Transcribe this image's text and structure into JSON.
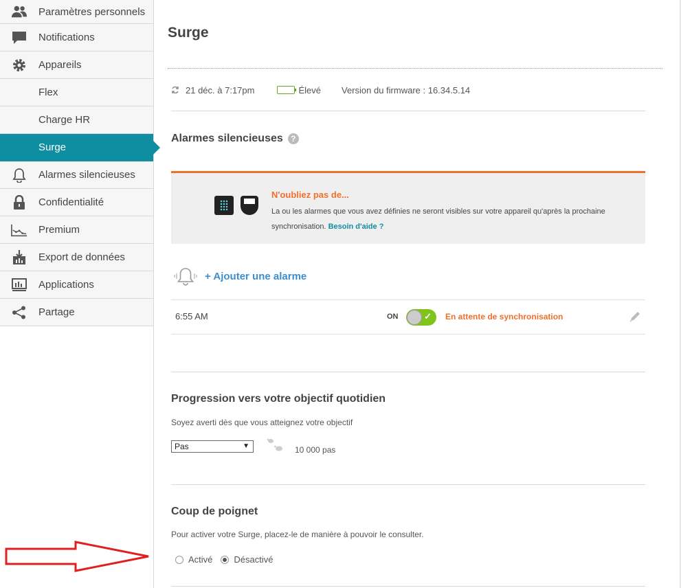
{
  "sidebar": {
    "items": [
      {
        "label": "Paramètres personnels",
        "icon": "users-icon"
      },
      {
        "label": "Notifications",
        "icon": "speech-bubble-icon"
      },
      {
        "label": "Appareils",
        "icon": "gear-icon"
      },
      {
        "label": "Flex",
        "icon": ""
      },
      {
        "label": "Charge HR",
        "icon": ""
      },
      {
        "label": "Surge",
        "icon": ""
      },
      {
        "label": "Alarmes silencieuses",
        "icon": "bell-icon"
      },
      {
        "label": "Confidentialité",
        "icon": "lock-icon"
      },
      {
        "label": "Premium",
        "icon": "line-chart-icon"
      },
      {
        "label": "Export de données",
        "icon": "download-icon"
      },
      {
        "label": "Applications",
        "icon": "monitor-icon"
      },
      {
        "label": "Partage",
        "icon": "share-icon"
      }
    ],
    "active": "Surge"
  },
  "main": {
    "title": "Surge",
    "status": {
      "sync_time": "21 déc. à 7:17pm",
      "battery_label": "Élevé",
      "firmware": "Version du firmware : 16.34.5.14"
    },
    "alarms": {
      "title": "Alarmes silencieuses",
      "help": "?",
      "notice_title": "N'oubliez pas de...",
      "notice_text": "La ou les alarmes que vous avez définies ne seront visibles sur votre appareil qu'après la prochaine synchronisation.",
      "notice_link": "Besoin d'aide ?",
      "add_label": "+ Ajouter une alarme",
      "list": [
        {
          "time": "6:55 AM",
          "state": "ON",
          "status": "En attente de synchronisation"
        }
      ]
    },
    "goal": {
      "title": "Progression vers votre objectif quotidien",
      "description": "Soyez averti dès que vous atteignez votre objectif",
      "selected": "Pas",
      "value": "10 000 pas"
    },
    "wrist": {
      "title": "Coup de poignet",
      "description": "Pour activer votre Surge, placez-le de manière à pouvoir le consulter.",
      "options": [
        "Activé",
        "Désactivé"
      ],
      "selected": "Désactivé"
    }
  },
  "colors": {
    "accent": "#0f8ea2",
    "orange": "#f06f2a",
    "green": "#7fc31c",
    "link_blue": "#3b8fd1",
    "annotation_red": "#e02020"
  }
}
